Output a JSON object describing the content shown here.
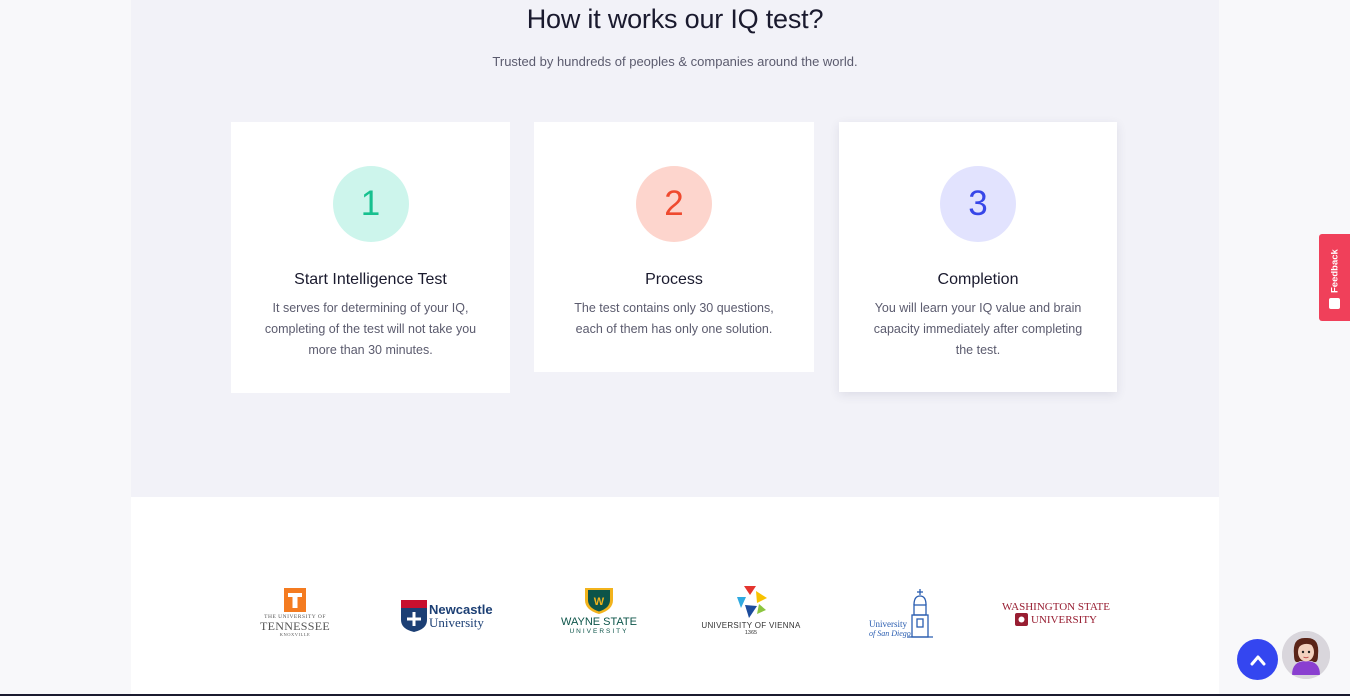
{
  "how_it_works": {
    "title": "How it works our IQ test?",
    "subtitle": "Trusted by hundreds of peoples & companies around the world.",
    "steps": [
      {
        "number": "1",
        "title": "Start Intelligence Test",
        "text": "It serves for determining of your IQ, completing of the test will not take you more than 30 minutes.",
        "circle_bg": "#cdf5ec",
        "number_color": "#17c08f"
      },
      {
        "number": "2",
        "title": "Process",
        "text": "The test contains only 30 questions, each of them has only one solution.",
        "circle_bg": "#fdd5cd",
        "number_color": "#ef4a2f"
      },
      {
        "number": "3",
        "title": "Completion",
        "text": "You will learn your IQ value and brain capacity immediately after completing the test.",
        "circle_bg": "#e2e3fe",
        "number_color": "#3746e8"
      }
    ]
  },
  "logos": [
    {
      "name": "university-of-tennessee-logo",
      "lines": [
        "THE UNIVERSITY OF",
        "TENNESSEE",
        "KNOXVILLE"
      ]
    },
    {
      "name": "newcastle-university-logo",
      "lines": [
        "Newcastle",
        "University"
      ]
    },
    {
      "name": "wayne-state-university-logo",
      "lines": [
        "WAYNE STATE",
        "UNIVERSITY"
      ]
    },
    {
      "name": "university-of-vienna-logo",
      "lines": [
        "UNIVERSITY OF VIENNA",
        "1365"
      ]
    },
    {
      "name": "university-of-san-diego-logo",
      "lines": [
        "University",
        "of San Diego"
      ]
    },
    {
      "name": "washington-state-university-logo",
      "lines": [
        "WASHINGTON STATE",
        "UNIVERSITY"
      ]
    }
  ],
  "feedback": {
    "label": "Feedback"
  },
  "colors": {
    "accent_blue": "#3446f0",
    "feedback_red": "#f0405a",
    "section_bg": "#f2f2f8"
  },
  "icons": {
    "scroll_top": "chevron-up-icon",
    "feedback": "feedback-icon",
    "avatar": "avatar"
  }
}
